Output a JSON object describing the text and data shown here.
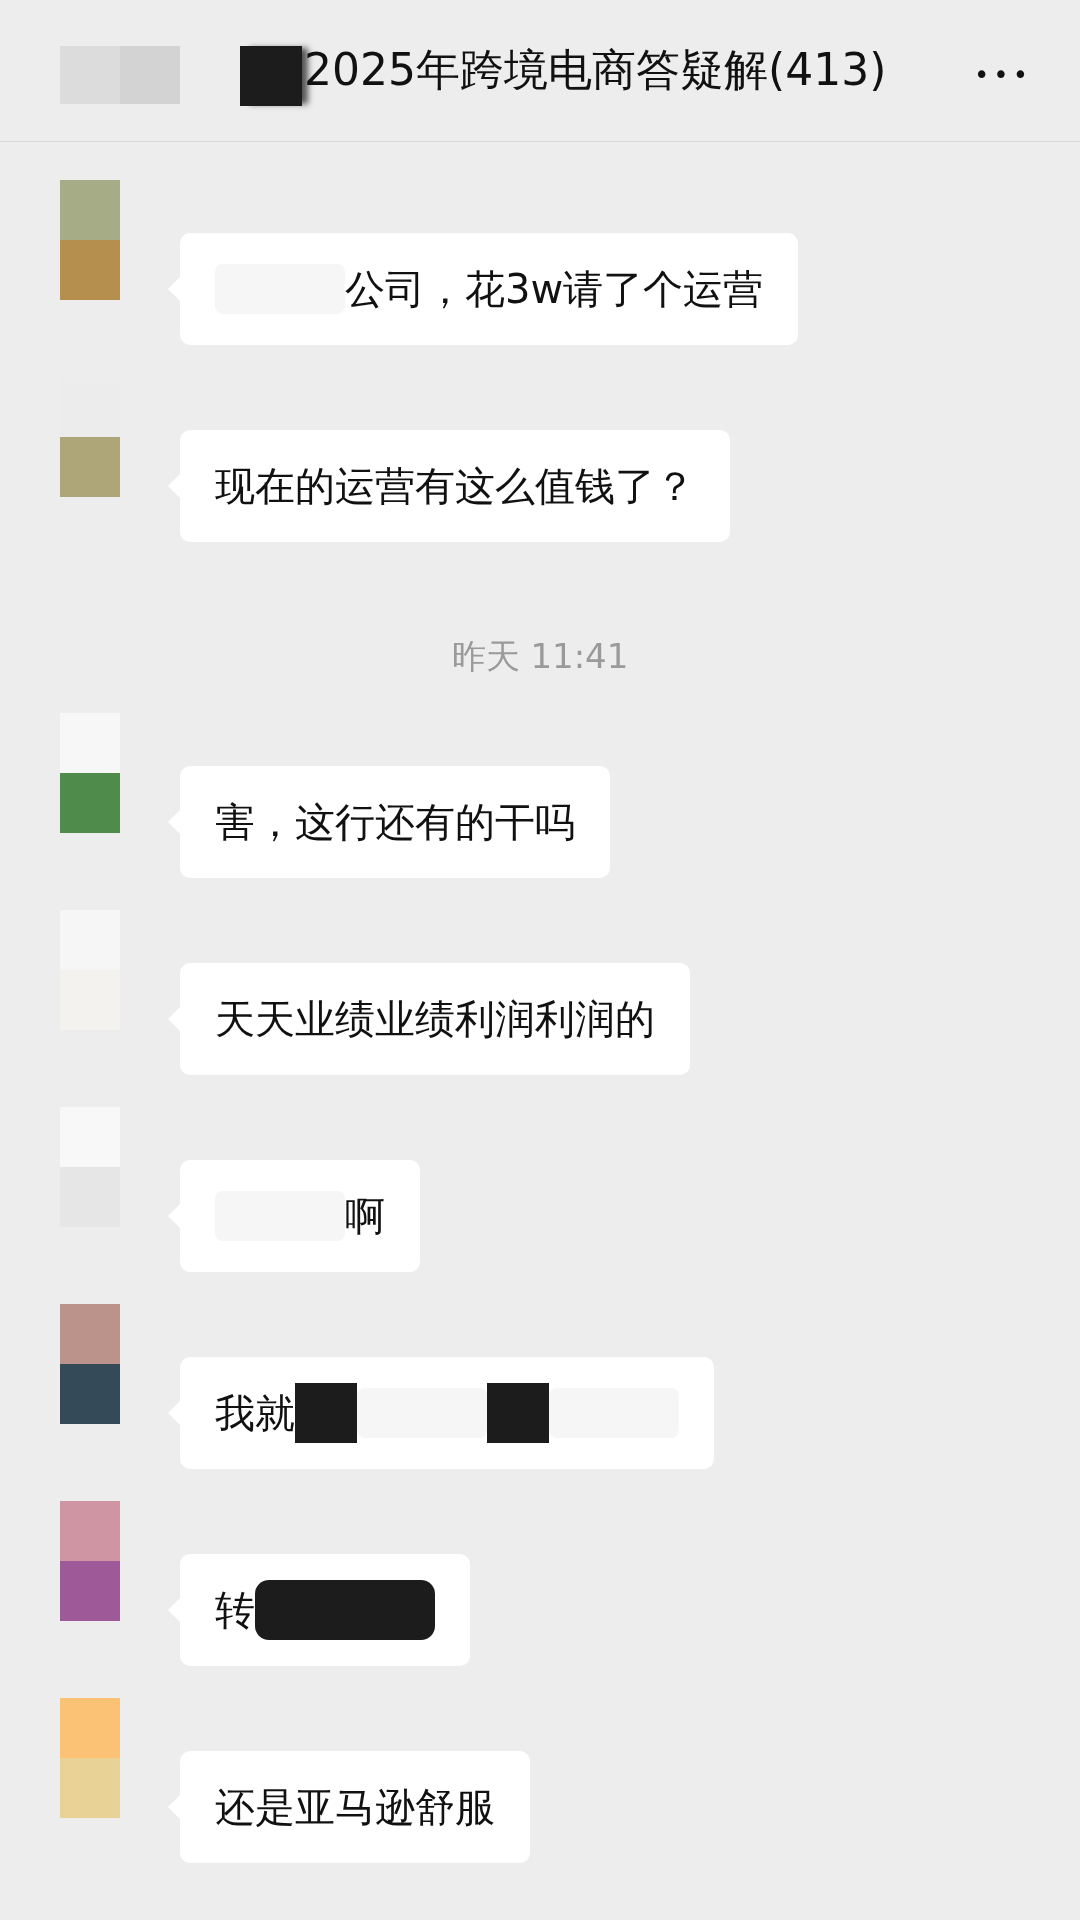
{
  "header": {
    "title": "2025年跨境电商答疑解(413)",
    "more_icon": "•••"
  },
  "messages": [
    {
      "kind": "message",
      "segments": [
        {
          "kind": "blur"
        },
        {
          "kind": "text",
          "text": "公司，花3w请了个运营"
        }
      ]
    },
    {
      "kind": "message",
      "segments": [
        {
          "kind": "text",
          "text": "现在的运营有这么值钱了？"
        }
      ]
    },
    {
      "kind": "time",
      "text": "昨天 11:41"
    },
    {
      "kind": "message",
      "segments": [
        {
          "kind": "text",
          "text": "害，这行还有的干吗"
        }
      ]
    },
    {
      "kind": "message",
      "segments": [
        {
          "kind": "text",
          "text": "天天业绩业绩利润利润的"
        }
      ]
    },
    {
      "kind": "message",
      "segments": [
        {
          "kind": "blur"
        },
        {
          "kind": "text",
          "text": "啊"
        }
      ]
    },
    {
      "kind": "message",
      "segments": [
        {
          "kind": "text",
          "text": "我就"
        },
        {
          "kind": "blackout"
        },
        {
          "kind": "blur"
        },
        {
          "kind": "blackout"
        },
        {
          "kind": "blur"
        }
      ]
    },
    {
      "kind": "message",
      "segments": [
        {
          "kind": "text",
          "text": "转"
        },
        {
          "kind": "blackout"
        }
      ]
    },
    {
      "kind": "message",
      "segments": [
        {
          "kind": "text",
          "text": "还是亚马逊舒服"
        }
      ]
    }
  ]
}
